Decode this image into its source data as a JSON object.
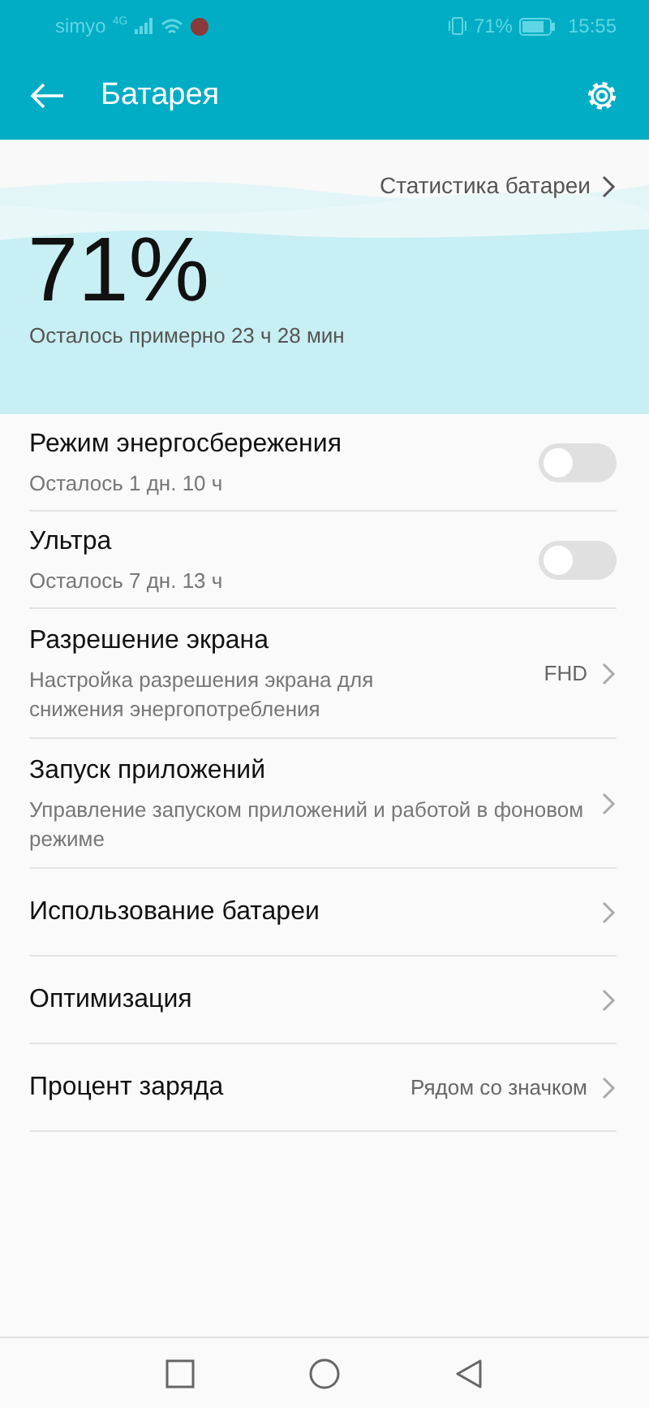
{
  "status_bar": {
    "carrier": "simyo",
    "network": "4G",
    "battery": "71%",
    "time": "15:55"
  },
  "app_bar": {
    "title": "Батарея"
  },
  "hero": {
    "link": "Статистика батареи",
    "percent": "71%",
    "remaining": "Осталось примерно 23 ч 28 мин"
  },
  "items": [
    {
      "kind": "toggle",
      "title": "Режим энергосбережения",
      "subtitle": "Осталось 1 дн. 10 ч",
      "on": false
    },
    {
      "kind": "toggle",
      "title": "Ультра",
      "subtitle": "Осталось 7 дн. 13 ч",
      "on": false
    },
    {
      "kind": "link",
      "title": "Разрешение экрана",
      "subtitle": "Настройка разрешения экрана для снижения энергопотребления",
      "value": "FHD"
    },
    {
      "kind": "link",
      "title": "Запуск приложений",
      "subtitle": "Управление запуском приложений и работой в фоновом режиме"
    },
    {
      "kind": "link",
      "title": "Использование батареи"
    },
    {
      "kind": "link",
      "title": "Оптимизация"
    },
    {
      "kind": "link",
      "title": "Процент заряда",
      "value": "Рядом со значком"
    }
  ]
}
